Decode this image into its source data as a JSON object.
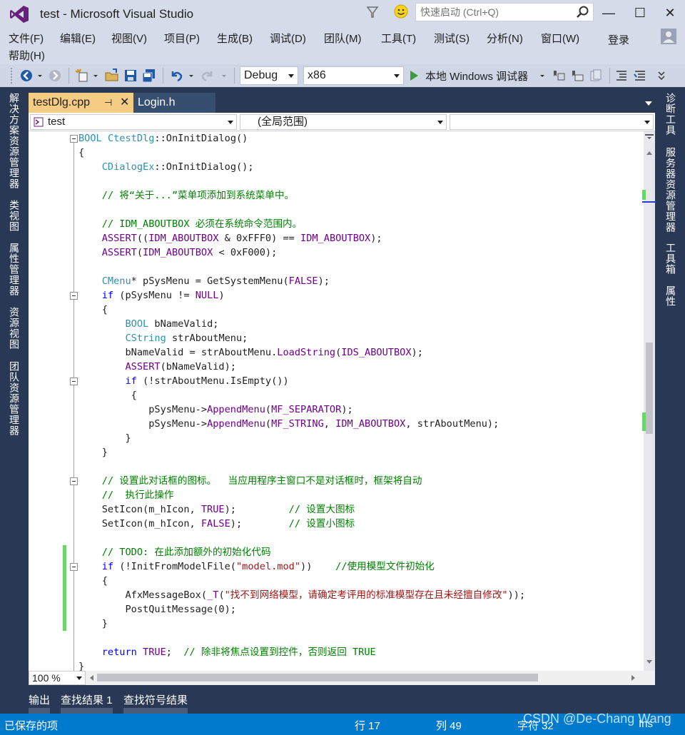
{
  "window": {
    "title": "test - Microsoft Visual Studio",
    "quick_launch_placeholder": "快速启动 (Ctrl+Q)",
    "minimize": "—",
    "maximize": "☐",
    "close": "✕"
  },
  "menu": {
    "items": [
      "文件(F)",
      "编辑(E)",
      "视图(V)",
      "项目(P)",
      "生成(B)",
      "调试(D)",
      "团队(M)",
      "工具(T)",
      "测试(S)",
      "分析(N)",
      "窗口(W)"
    ],
    "help": "帮助(H)",
    "login": "登录"
  },
  "toolbar": {
    "config": "Debug",
    "platform": "x86",
    "run_label": "本地 Windows 调试器"
  },
  "left_tool_tabs": [
    "解决方案资源管理器",
    "类视图",
    "属性管理器",
    "资源视图",
    "团队资源管理器"
  ],
  "right_tool_tabs": [
    "诊断工具",
    "服务器资源管理器",
    "工具箱",
    "属性"
  ],
  "doc_tabs": {
    "active": "testDlg.cpp",
    "pin": "⊣",
    "close": "✕",
    "inactive": "Login.h"
  },
  "nav": {
    "project": "test",
    "scope": "(全局范围)",
    "member": ""
  },
  "code_lines": [
    "BOOL CtestDlg::OnInitDialog()",
    "{",
    "    CDialogEx::OnInitDialog();",
    "",
    "    // 将“关于...”菜单项添加到系统菜单中。",
    "",
    "    // IDM_ABOUTBOX 必须在系统命令范围内。",
    "    ASSERT((IDM_ABOUTBOX & 0xFFF0) == IDM_ABOUTBOX);",
    "    ASSERT(IDM_ABOUTBOX < 0xF000);",
    "",
    "    CMenu* pSysMenu = GetSystemMenu(FALSE);",
    "    if (pSysMenu != NULL)",
    "    {",
    "        BOOL bNameValid;",
    "        CString strAboutMenu;",
    "        bNameValid = strAboutMenu.LoadString(IDS_ABOUTBOX);",
    "        ASSERT(bNameValid);",
    "        if (!strAboutMenu.IsEmpty())",
    "         {",
    "            pSysMenu->AppendMenu(MF_SEPARATOR);",
    "            pSysMenu->AppendMenu(MF_STRING, IDM_ABOUTBOX, strAboutMenu);",
    "        }",
    "    }",
    "",
    "    // 设置此对话框的图标。  当应用程序主窗口不是对话框时，框架将自动",
    "    //  执行此操作",
    "    SetIcon(m_hIcon, TRUE);         // 设置大图标",
    "    SetIcon(m_hIcon, FALSE);        // 设置小图标",
    "",
    "    // TODO: 在此添加额外的初始化代码",
    "    if (!InitFromModelFile(\"model.mod\"))    //使用模型文件初始化",
    "    {",
    "        AfxMessageBox(_T(\"找不到网络模型，请确定考评用的标准模型存在且未经擅自修改\"));",
    "        PostQuitMessage(0);",
    "    }",
    "",
    "    return TRUE;  // 除非将焦点设置到控件，否则返回 TRUE",
    "}"
  ],
  "zoom": "100 %",
  "output_tabs": [
    "输出",
    "查找结果 1",
    "查找符号结果"
  ],
  "status": {
    "message": "已保存的项",
    "line": "行 17",
    "col": "列 49",
    "char": "字符 32",
    "mode": "Ins"
  },
  "watermark": "CSDN @De-Chang Wang"
}
